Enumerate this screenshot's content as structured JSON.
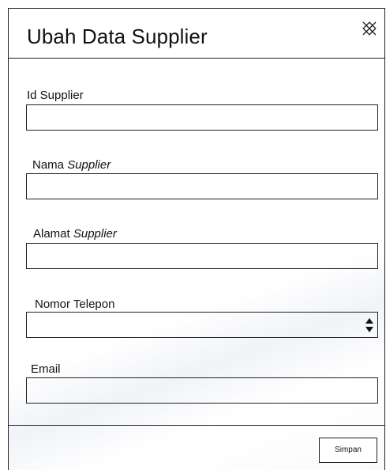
{
  "dialog": {
    "title": "Ubah Data Supplier",
    "close_icon": "close-icon"
  },
  "fields": {
    "id_supplier": {
      "label": "Id Supplier",
      "value": ""
    },
    "nama_supplier": {
      "label_prefix": "Nama ",
      "label_em": "Supplier",
      "value": ""
    },
    "alamat_supplier": {
      "label_prefix": "Alamat ",
      "label_em": "Supplier",
      "value": ""
    },
    "nomor_telepon": {
      "label": "Nomor Telepon",
      "value": "",
      "spinner_icon": "spinner-arrows-icon"
    },
    "email": {
      "label": "Email",
      "value": ""
    }
  },
  "footer": {
    "save_label": "Simpan"
  }
}
